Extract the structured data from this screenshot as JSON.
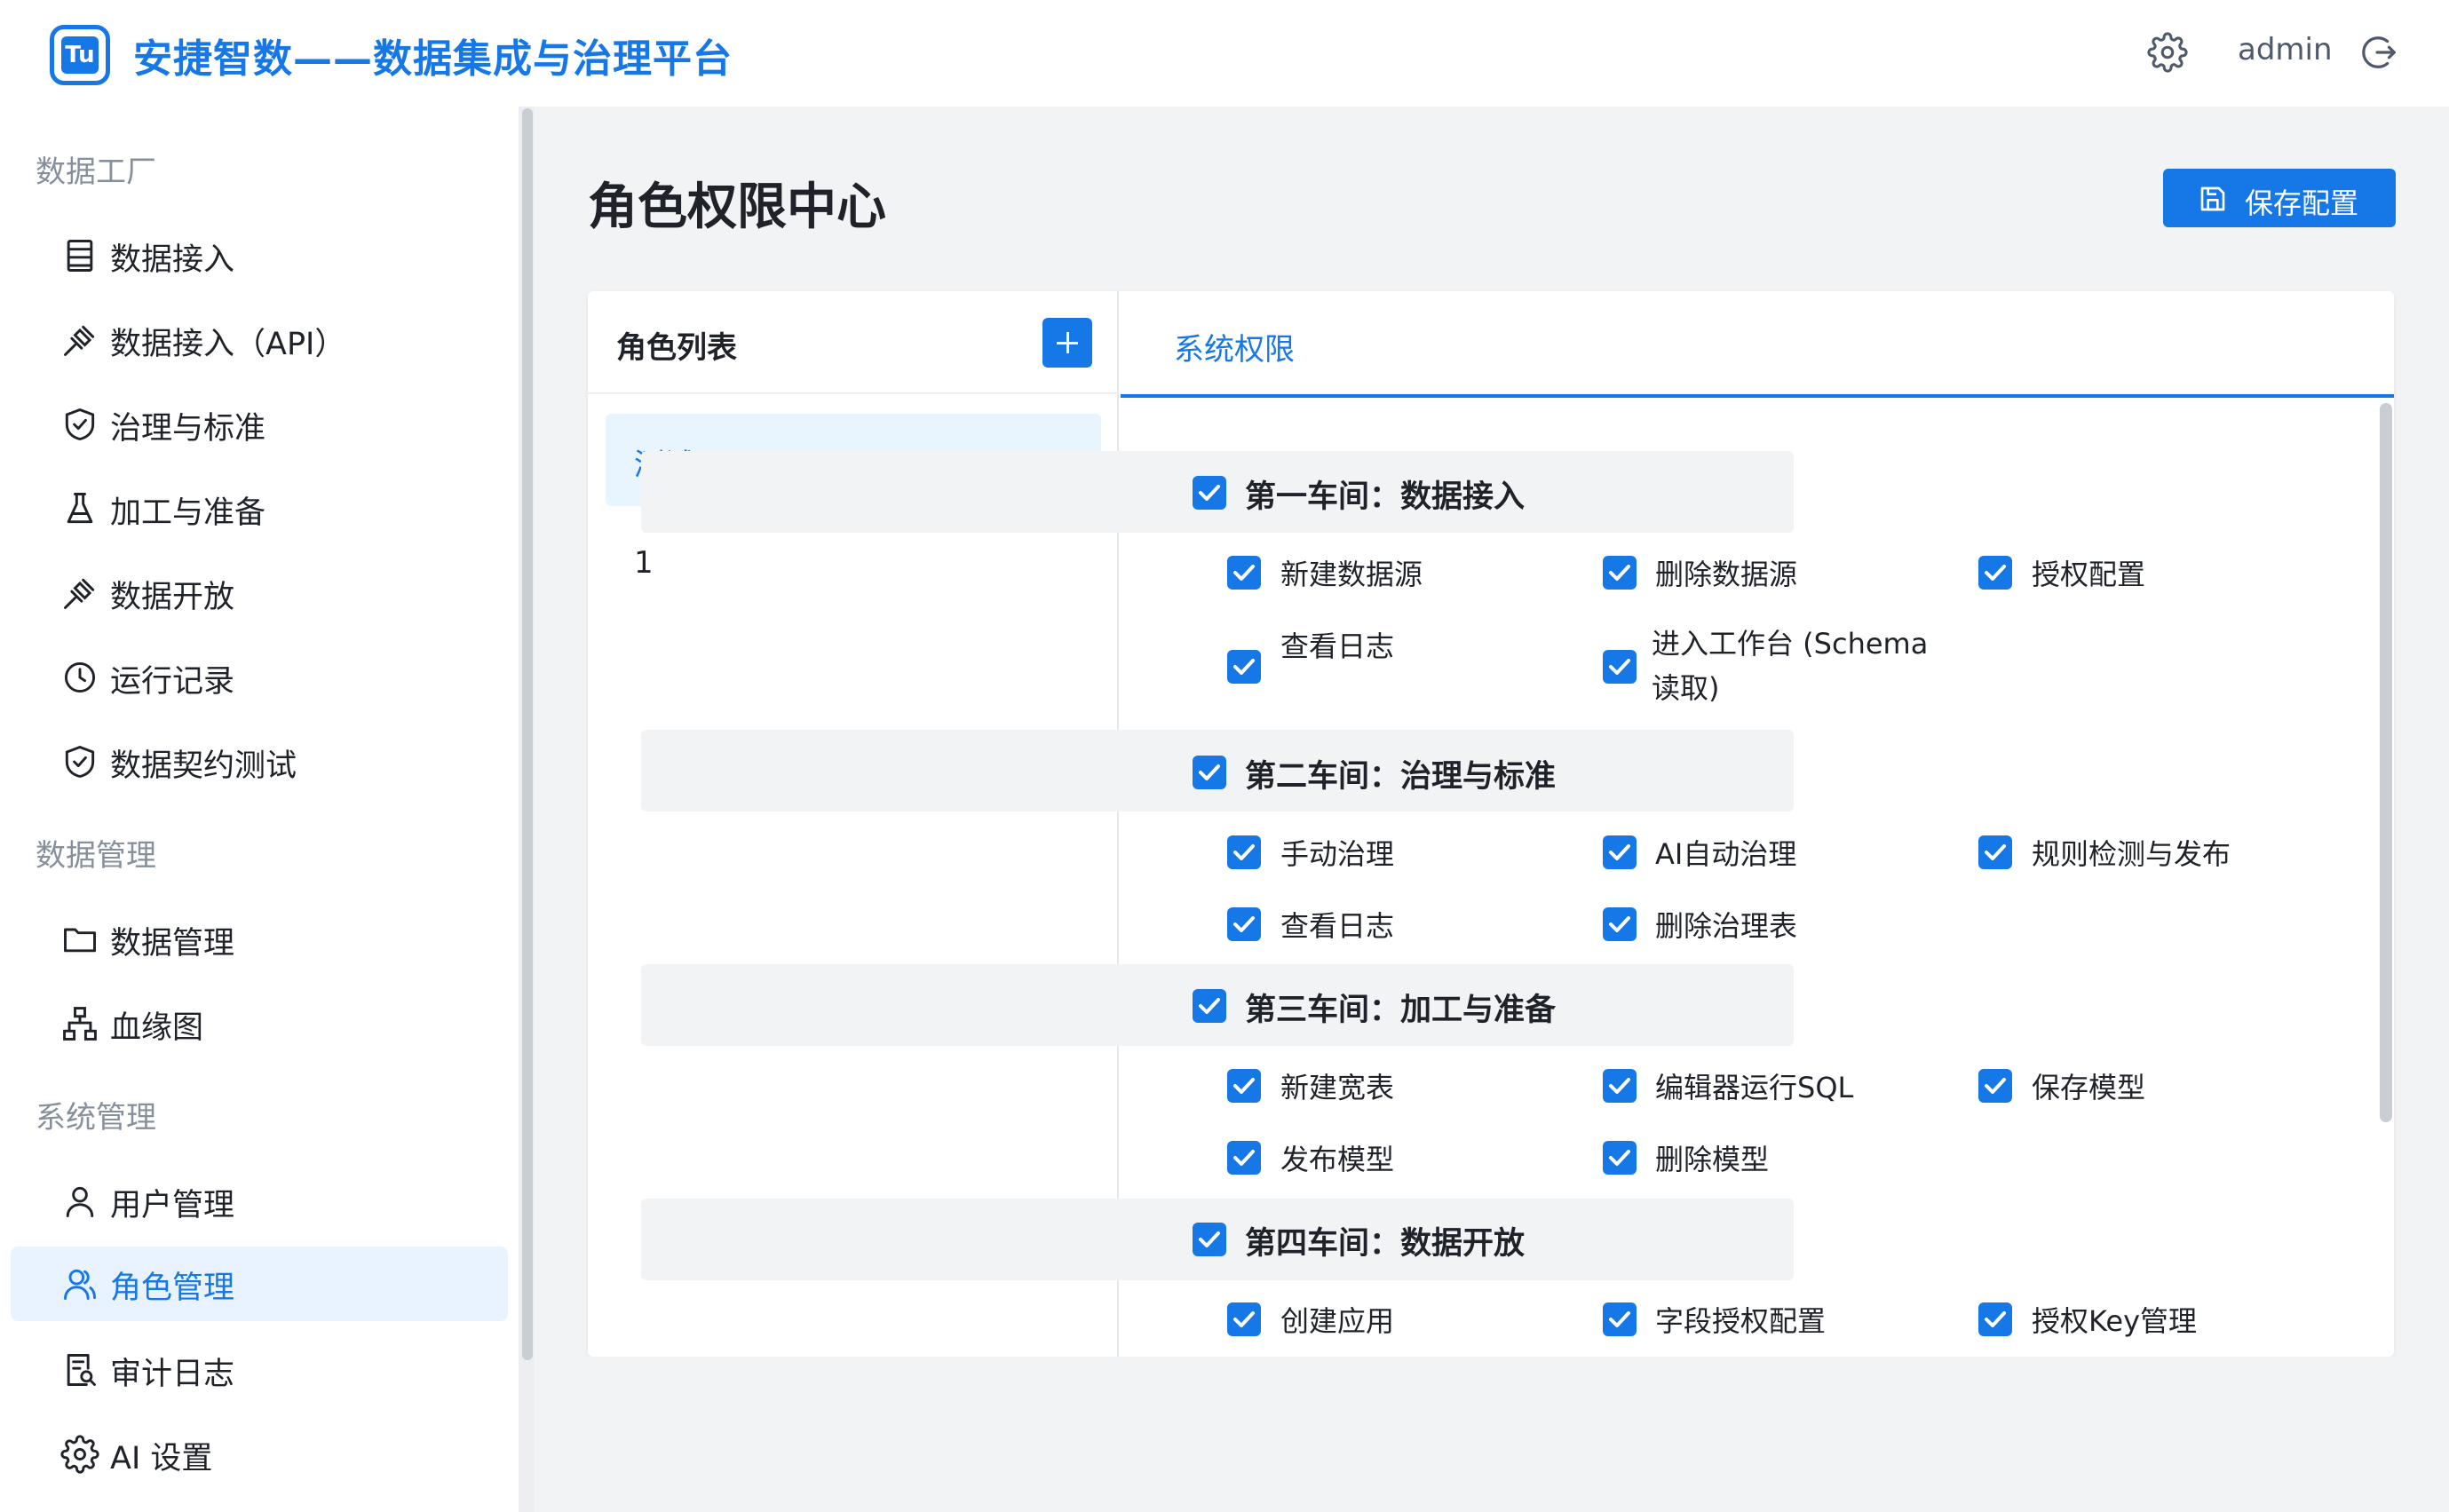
{
  "header": {
    "logo_text": "Tu",
    "app_title": "安捷智数——数据集成与治理平台",
    "username": "admin"
  },
  "sidebar": {
    "groups": [
      {
        "label": "数据工厂"
      },
      {
        "label": "数据管理"
      },
      {
        "label": "系统管理"
      }
    ],
    "items": [
      {
        "label": "数据接入",
        "icon": "list-icon"
      },
      {
        "label": "数据接入（API）",
        "icon": "plug-icon"
      },
      {
        "label": "治理与标准",
        "icon": "shield-icon"
      },
      {
        "label": "加工与准备",
        "icon": "flask-icon"
      },
      {
        "label": "数据开放",
        "icon": "plug-icon"
      },
      {
        "label": "运行记录",
        "icon": "clock-icon"
      },
      {
        "label": "数据契约测试",
        "icon": "shield-icon"
      },
      {
        "label": "数据管理",
        "icon": "folder-icon"
      },
      {
        "label": "血缘图",
        "icon": "hierarchy-icon"
      },
      {
        "label": "用户管理",
        "icon": "user-icon"
      },
      {
        "label": "角色管理",
        "icon": "users-icon"
      },
      {
        "label": "审计日志",
        "icon": "audit-icon"
      },
      {
        "label": "AI 设置",
        "icon": "gear-icon"
      }
    ],
    "active_item": "角色管理"
  },
  "main": {
    "page_title": "角色权限中心",
    "save_button": "保存配置",
    "roles_panel": {
      "title": "角色列表",
      "roles": [
        "测试",
        "1"
      ],
      "selected_role": "测试"
    },
    "permissions": {
      "tab_label": "系统权限",
      "sections": [
        {
          "title": "第一车间：数据接入",
          "checked": true,
          "items": [
            {
              "label": "新建数据源",
              "checked": true
            },
            {
              "label": "删除数据源",
              "checked": true
            },
            {
              "label": "授权配置",
              "checked": true
            },
            {
              "label": "查看日志",
              "checked": true
            },
            {
              "label": "进入工作台 (Schema 读取)",
              "checked": true
            }
          ]
        },
        {
          "title": "第二车间：治理与标准",
          "checked": true,
          "items": [
            {
              "label": "手动治理",
              "checked": true
            },
            {
              "label": "AI自动治理",
              "checked": true
            },
            {
              "label": "规则检测与发布",
              "checked": true
            },
            {
              "label": "查看日志",
              "checked": true
            },
            {
              "label": "删除治理表",
              "checked": true
            }
          ]
        },
        {
          "title": "第三车间：加工与准备",
          "checked": true,
          "items": [
            {
              "label": "新建宽表",
              "checked": true
            },
            {
              "label": "编辑器运行SQL",
              "checked": true
            },
            {
              "label": "保存模型",
              "checked": true
            },
            {
              "label": "发布模型",
              "checked": true
            },
            {
              "label": "删除模型",
              "checked": true
            }
          ]
        },
        {
          "title": "第四车间：数据开放",
          "checked": true,
          "items": [
            {
              "label": "创建应用",
              "checked": true
            },
            {
              "label": "字段授权配置",
              "checked": true
            },
            {
              "label": "授权Key管理",
              "checked": true
            }
          ]
        }
      ]
    }
  },
  "colors": {
    "primary": "#1677e6",
    "active_bg": "#e8f3ff",
    "page_bg": "#f2f3f5",
    "muted_text": "#86909c"
  }
}
